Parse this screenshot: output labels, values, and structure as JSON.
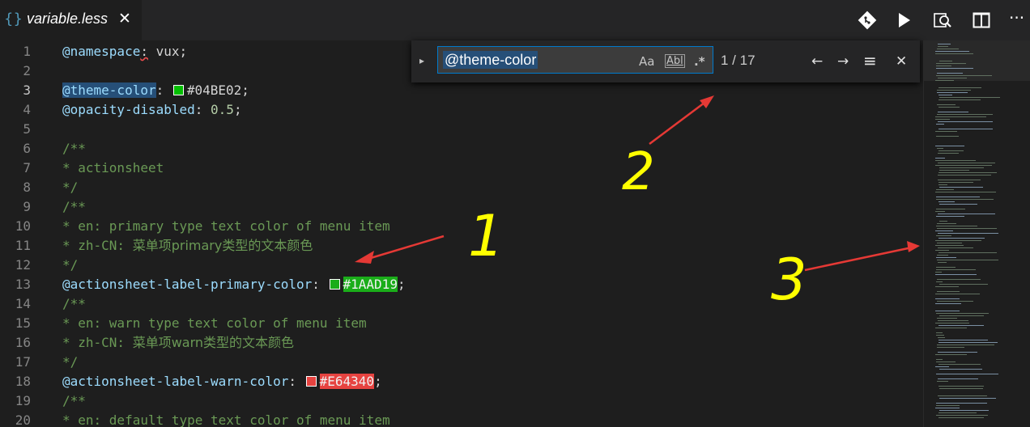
{
  "tab": {
    "icon": "{}",
    "title": "variable.less",
    "close": "✕"
  },
  "toolbar": {
    "icons": [
      "git-compare-icon",
      "run-icon",
      "open-preview-icon",
      "split-editor-icon",
      "more-actions-icon"
    ],
    "more": "···"
  },
  "find_widget": {
    "toggle_glyph": "▸",
    "query": "@theme-color",
    "match_case": "Aa",
    "whole_word": "Abl",
    "regex": ".*",
    "match_count": "1 / 17",
    "prev": "←",
    "next": "→",
    "select_all_glyph": "≡",
    "close": "✕"
  },
  "editor": {
    "line_numbers": [
      "1",
      "2",
      "3",
      "4",
      "5",
      "6",
      "7",
      "8",
      "9",
      "10",
      "11",
      "12",
      "13",
      "14",
      "15",
      "16",
      "17",
      "18",
      "19",
      "20"
    ],
    "active_line": "3",
    "code": {
      "l1_var": "@namespace",
      "l1_colon": ":",
      "l1_val": " vux;",
      "l3_var": "@theme-color",
      "l3_colon": ": ",
      "l3_val": "#04BE02;",
      "l4_var": "@opacity-disabled",
      "l4_colon": ": ",
      "l4_val": "0.5",
      "l4_semi": ";",
      "l6": "/**",
      "l7": "* actionsheet",
      "l8": "*/",
      "l9": "/**",
      "l10": "* en: primary type text color of menu item",
      "l11_a": "* zh-CN: ",
      "l11_b": "菜单项primary类型的文本颜色",
      "l12": "*/",
      "l13_var": "@actionsheet-label-primary-color",
      "l13_colon": ": ",
      "l13_val": "#1AAD19",
      "l13_semi": ";",
      "l14": "/**",
      "l15": "* en: warn type text color of menu item",
      "l16_a": "* zh-CN: ",
      "l16_b": "菜单项warn类型的文本颜色",
      "l17": "*/",
      "l18_var": "@actionsheet-label-warn-color",
      "l18_colon": ": ",
      "l18_val": "#E64340",
      "l18_semi": ";",
      "l19": "/**",
      "l20": "* en: default type text color of menu item"
    }
  },
  "colors": {
    "theme": "#04BE02",
    "primary": "#1AAD19",
    "warn": "#E64340",
    "accent": "#007acc"
  },
  "annotations": {
    "label_1": "1",
    "label_2": "2",
    "label_3": "3",
    "arrow_color": "#e53935",
    "text_color": "#ffff00"
  }
}
